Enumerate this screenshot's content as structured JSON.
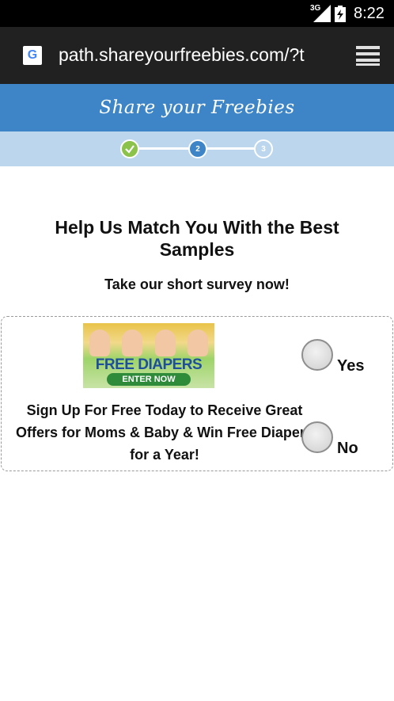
{
  "status_bar": {
    "network": "3G",
    "time": "8:22"
  },
  "browser": {
    "url": "path.shareyourfreebies.com/?t"
  },
  "site": {
    "brand": "Share your Freebies",
    "steps": [
      "",
      "2",
      "3"
    ]
  },
  "content": {
    "headline": "Help Us Match You With the Best Samples",
    "subhead": "Take our short survey now!",
    "ad": {
      "title": "FREE DIAPERS",
      "cta": "ENTER NOW"
    },
    "offer_text": "Sign Up For Free Today to Receive Great Offers for Moms & Baby & Win Free Diapers for a Year!",
    "options": [
      {
        "label": "Yes"
      },
      {
        "label": "No"
      }
    ]
  },
  "colors": {
    "header_blue": "#3d85c6",
    "progress_bg": "#bcd6ee",
    "done_green": "#8bc34a"
  }
}
